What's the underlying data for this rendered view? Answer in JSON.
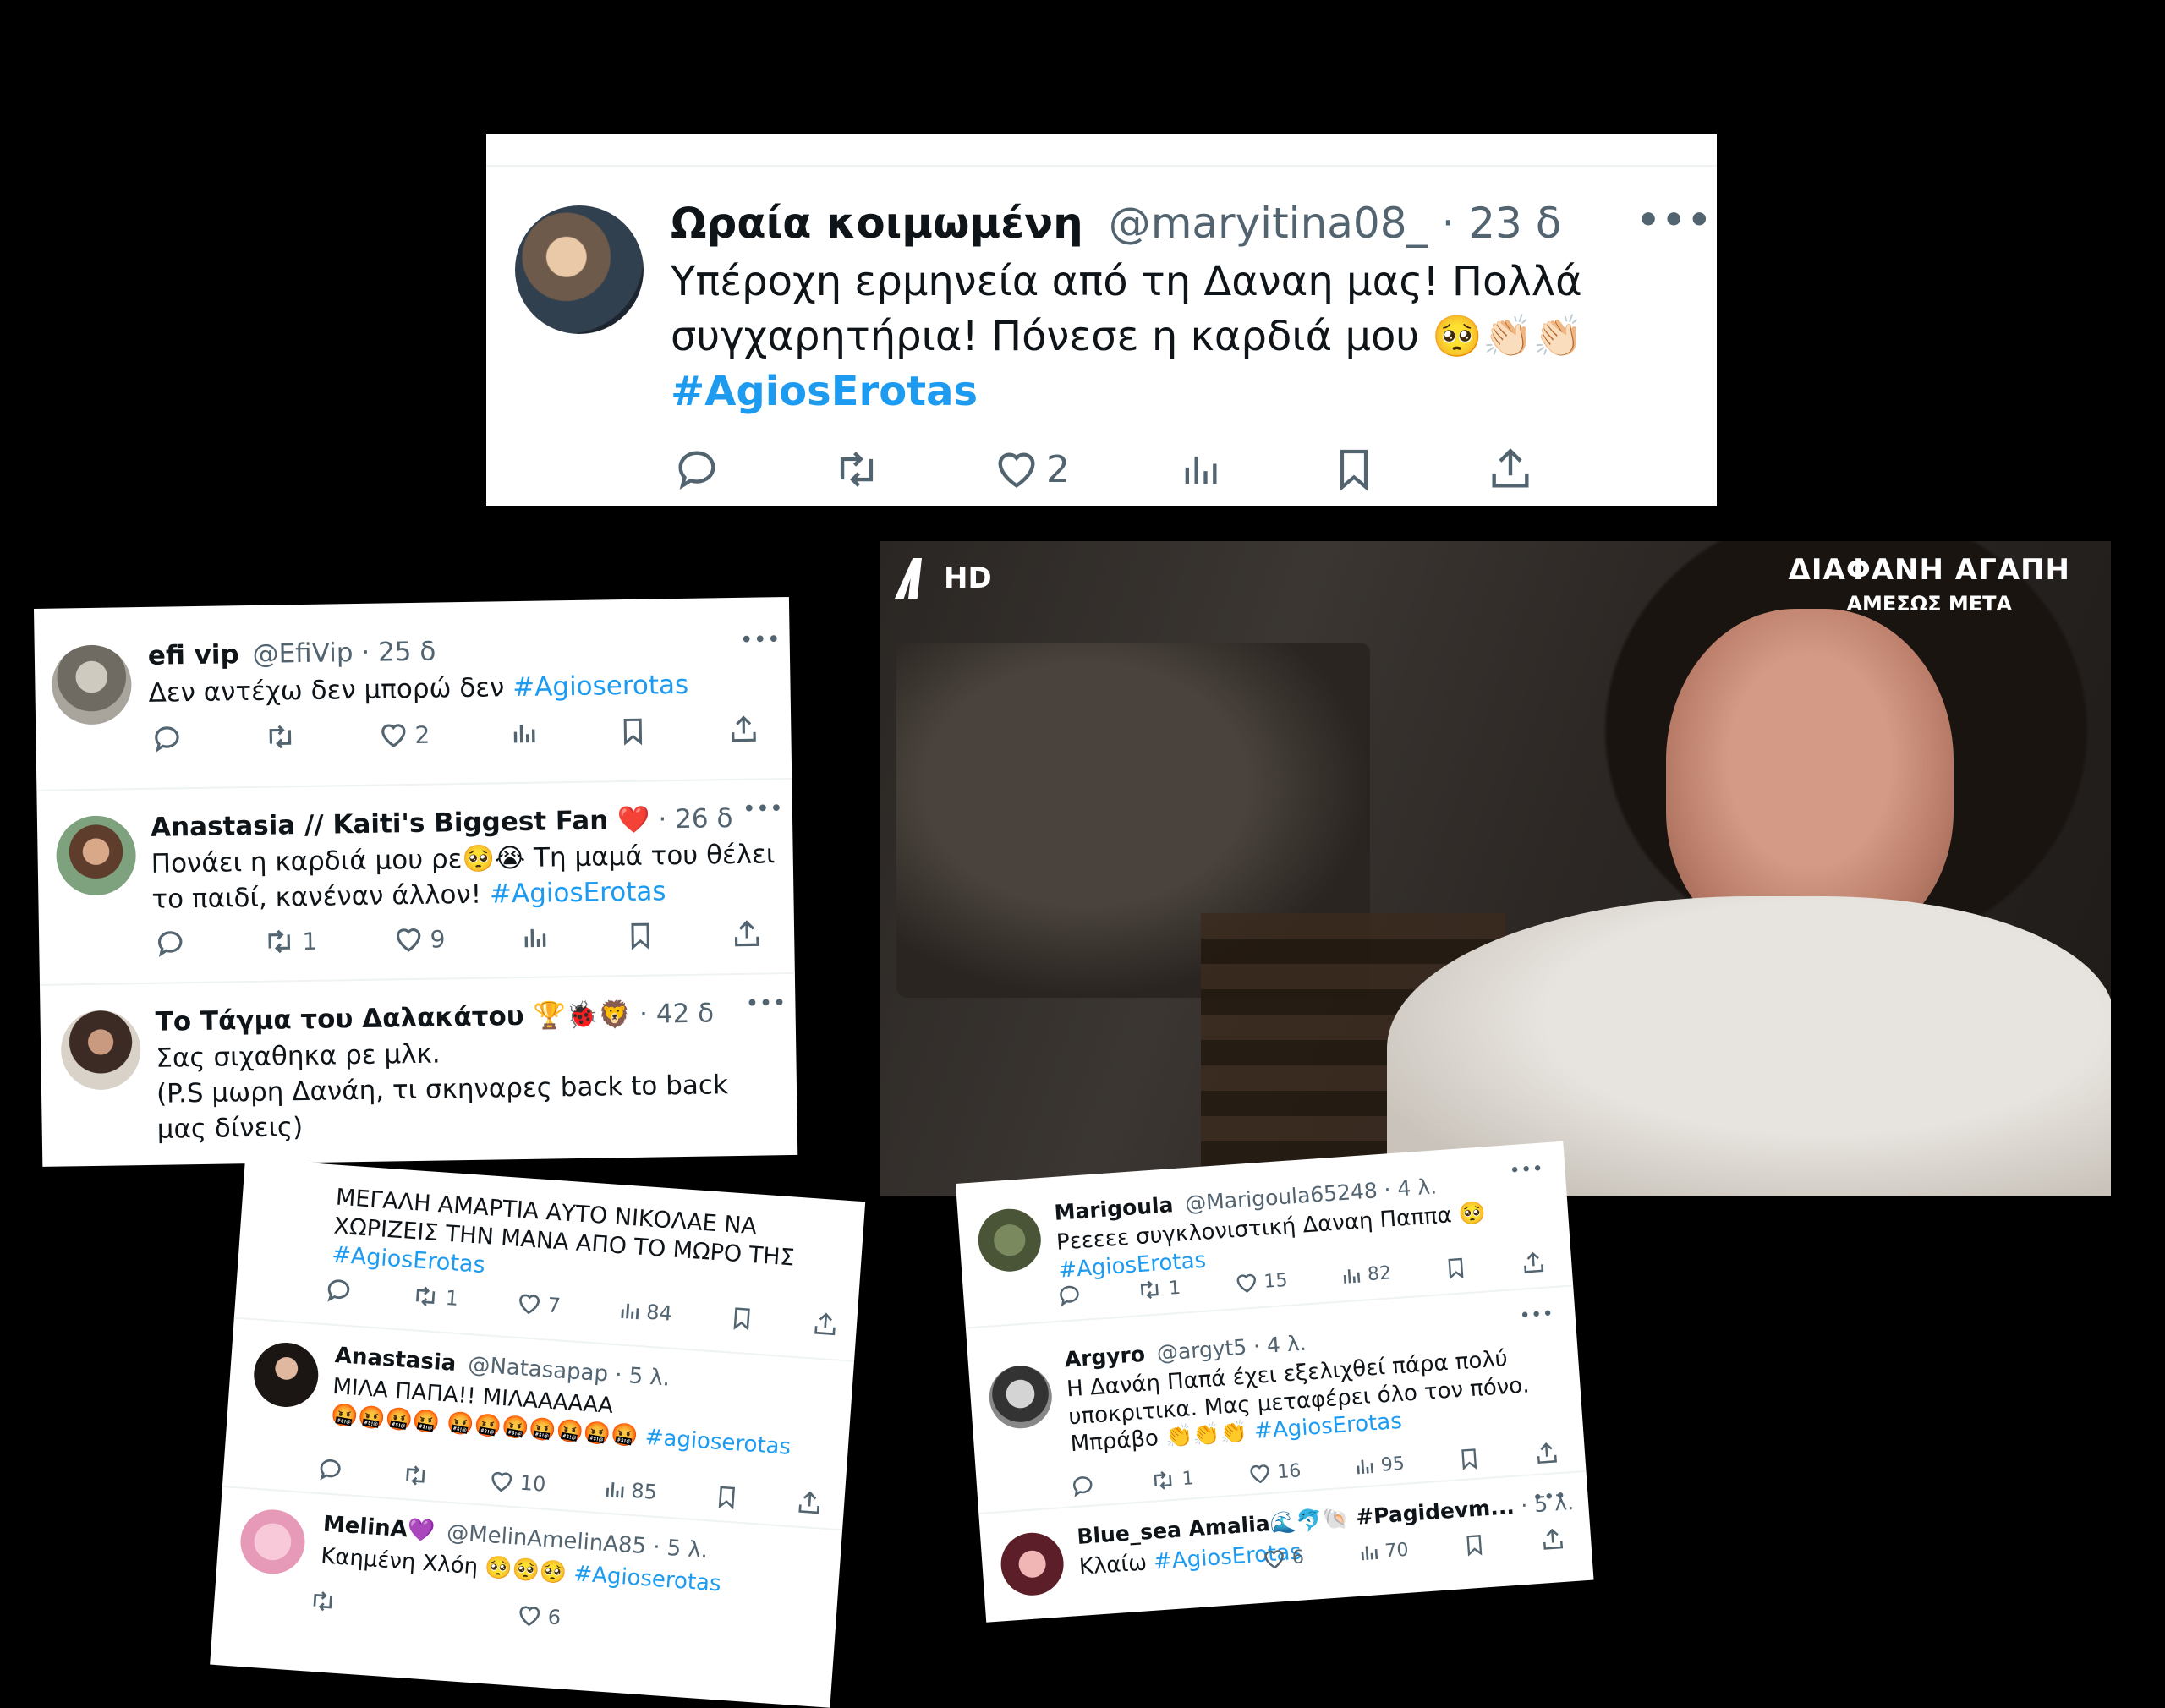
{
  "main_tweet": {
    "name": "Ωραία κοιμωμένη",
    "handle": "@maryitina08_",
    "time": "· 23 δ",
    "text": "Υπέροχη ερμηνεία από τη Δαναη μας! Πολλά συγχαρητήρια! Πόνεσε η καρδιά μου 🥺👏🏻👏🏻",
    "hashtag": "#AgiosErotas",
    "likes": "2"
  },
  "left_panel": [
    {
      "name": "efi vip",
      "handle": "@EfiVip",
      "time": "· 25 δ",
      "text": "Δεν αντέχω δεν μπορώ δεν ",
      "hashtag": "#Agioserotas",
      "retweets": "",
      "likes": "2"
    },
    {
      "name": "Anastasia // Kaiti's Biggest Fan ❤️",
      "handle": "",
      "time": "· 26 δ",
      "text": "Πονάει η καρδιά μου ρε🥺😭 Τη μαμά του θέλει το παιδί, κανέναν άλλον! ",
      "hashtag": "#AgiosErotas",
      "retweets": "1",
      "likes": "9"
    },
    {
      "name": "Το Τάγμα του Δαλακάτου 🏆🐞🦁",
      "handle": "",
      "time": "· 42 δ",
      "text": "Σας σιχαθηκα ρε μλκ.",
      "text2": "(P.S μωρη Δανάη, τι σκηναρες back to back μας δίνεις)"
    }
  ],
  "bottom_left_panel": {
    "first_text": "ΜΕΓΑΛΗ ΑΜΑΡΤΙΑ ΑΥΤΟ ΝΙΚΟΛΑΕ ΝΑ ΧΩΡΙΖΕΙΣ ΤΗΝ ΜΑΝΑ ΑΠΟ ΤΟ ΜΩΡΟ ΤΗΣ",
    "first_hashtag": "#AgiosErotas",
    "first_retweets": "1",
    "first_likes": "7",
    "first_views": "84",
    "second": {
      "name": "Anastasia",
      "handle": "@Natasapap",
      "time": "· 5 λ.",
      "text": "ΜΙΛΑ ΠΑΠΑ!! ΜΙΛΑΑΑΑΑΑ",
      "emoji": "🤬🤬🤬🤬 🤬🤬🤬🤬🤬🤬🤬",
      "hashtag": "#agioserotas",
      "likes": "10",
      "views": "85"
    },
    "third": {
      "name": "MelinA💜",
      "handle": "@MelinAmelinA85",
      "time": "· 5 λ.",
      "text": "Καημένη Χλόη 🥺🥺🥺",
      "hashtag": "#Agioserotas",
      "likes": "6"
    }
  },
  "bottom_right_panel": [
    {
      "name": "Marigoula",
      "handle": "@Marigoula65248",
      "time": "· 4 λ.",
      "text": "Ρεεεεε συγκλονιστική Δαναη Παππα 🥺",
      "hashtag": "#AgiosErotas",
      "retweets": "1",
      "likes": "15",
      "views": "82"
    },
    {
      "name": "Argyro",
      "handle": "@argyt5",
      "time": "· 4 λ.",
      "text": "Η Δανάη Παπά έχει εξελιχθεί πάρα πολύ υποκριτικα. Μας μεταφέρει όλο τον πόνο. Μπράβο 👏👏👏 ",
      "hashtag": "#AgiosErotas",
      "retweets": "1",
      "likes": "16",
      "views": "95"
    },
    {
      "name": "Blue_sea Amalia🌊🐬🐚 #Pagidevm...",
      "handle": "",
      "time": "· 5 λ.",
      "text": "Κλαίω ",
      "hashtag": "#AgiosErotas",
      "likes": "6",
      "views": "70"
    }
  ],
  "tv_frame": {
    "channel_logo": "HD",
    "promo_title": "ΔΙΑΦΑΝΗ ΑΓΑΠΗ",
    "promo_sub": "ΑΜΕΣΩΣ ΜΕΤΑ"
  },
  "colors": {
    "hashtag": "#1d9bf0",
    "muted": "#536471",
    "text": "#0f1419"
  }
}
